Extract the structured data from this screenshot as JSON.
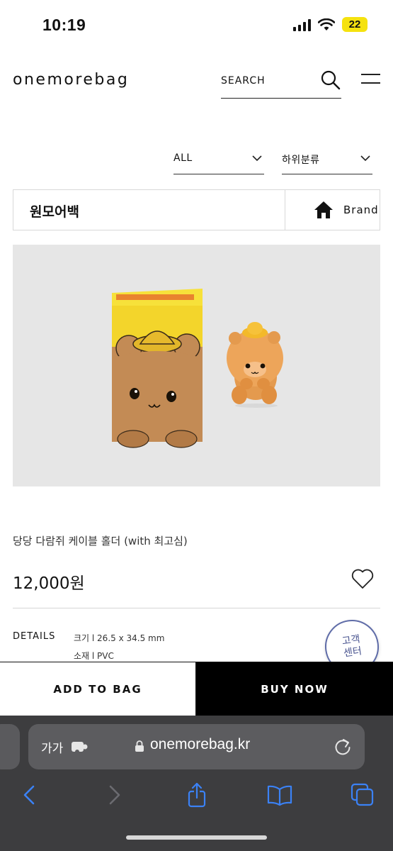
{
  "status_bar": {
    "time": "10:19",
    "battery": "22"
  },
  "header": {
    "logo": "onemorebag",
    "search_label": "SEARCH"
  },
  "filters": {
    "category": "ALL",
    "subcategory": "하위분류"
  },
  "breadcrumb": {
    "title": "원모어백",
    "brand_label": "Brand"
  },
  "product": {
    "name": "당당 다람쥐 케이블 홀더 (with 최고심)",
    "price": "12,000원",
    "details_label": "DETAILS",
    "details": [
      "크기 l 26.5 x 34.5 mm",
      "소재 l PVC"
    ]
  },
  "customer_center": {
    "line1": "고객",
    "line2": "센터"
  },
  "actions": {
    "add_to_bag": "ADD TO BAG",
    "buy_now": "BUY NOW"
  },
  "browser": {
    "aa_label": "가가",
    "url": "onemorebag.kr"
  },
  "colors": {
    "battery": "#f5e20f",
    "buy_now_bg": "#000000",
    "box_yellow": "#f3d52b",
    "bear_brown": "#c9915c",
    "safari_bg": "#3d3d3f",
    "safari_accent": "#3b82f6"
  }
}
